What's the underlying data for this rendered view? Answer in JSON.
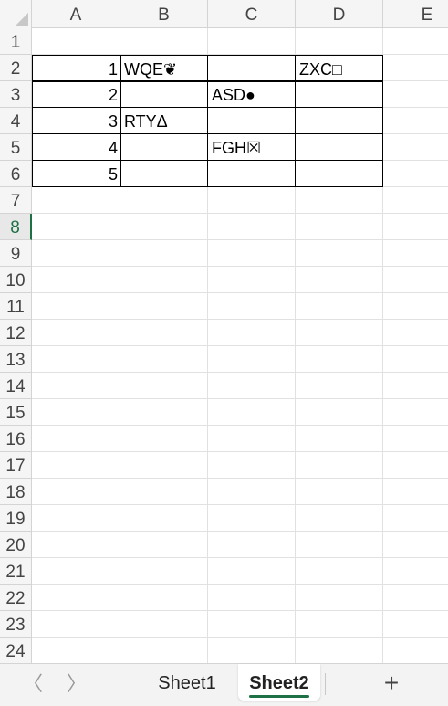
{
  "columns": [
    "A",
    "B",
    "C",
    "D",
    "E"
  ],
  "rows": [
    "1",
    "2",
    "3",
    "4",
    "5",
    "6",
    "7",
    "8",
    "9",
    "10",
    "11",
    "12",
    "13",
    "14",
    "15",
    "16",
    "17",
    "18",
    "19",
    "20",
    "21",
    "22",
    "23",
    "24"
  ],
  "active_row": "8",
  "cells": {
    "A2": "1",
    "A3": "2",
    "A4": "3",
    "A5": "4",
    "A6": "5",
    "B2": "WQE❦",
    "B4": "RTYΔ",
    "C3": "ASD●",
    "C5": "FGH☒",
    "D2": "ZXC□"
  },
  "tabbar": {
    "prev_icon": "chevron-left-icon",
    "next_icon": "chevron-right-icon",
    "prev_glyph": "〈",
    "next_glyph": "〉",
    "sheets": [
      "Sheet1",
      "Sheet2"
    ],
    "active_sheet": "Sheet2",
    "add_glyph": "+"
  },
  "colors": {
    "accent": "#1e7145",
    "gridline": "#e1e1e1",
    "header_bg": "#f5f5f5"
  }
}
